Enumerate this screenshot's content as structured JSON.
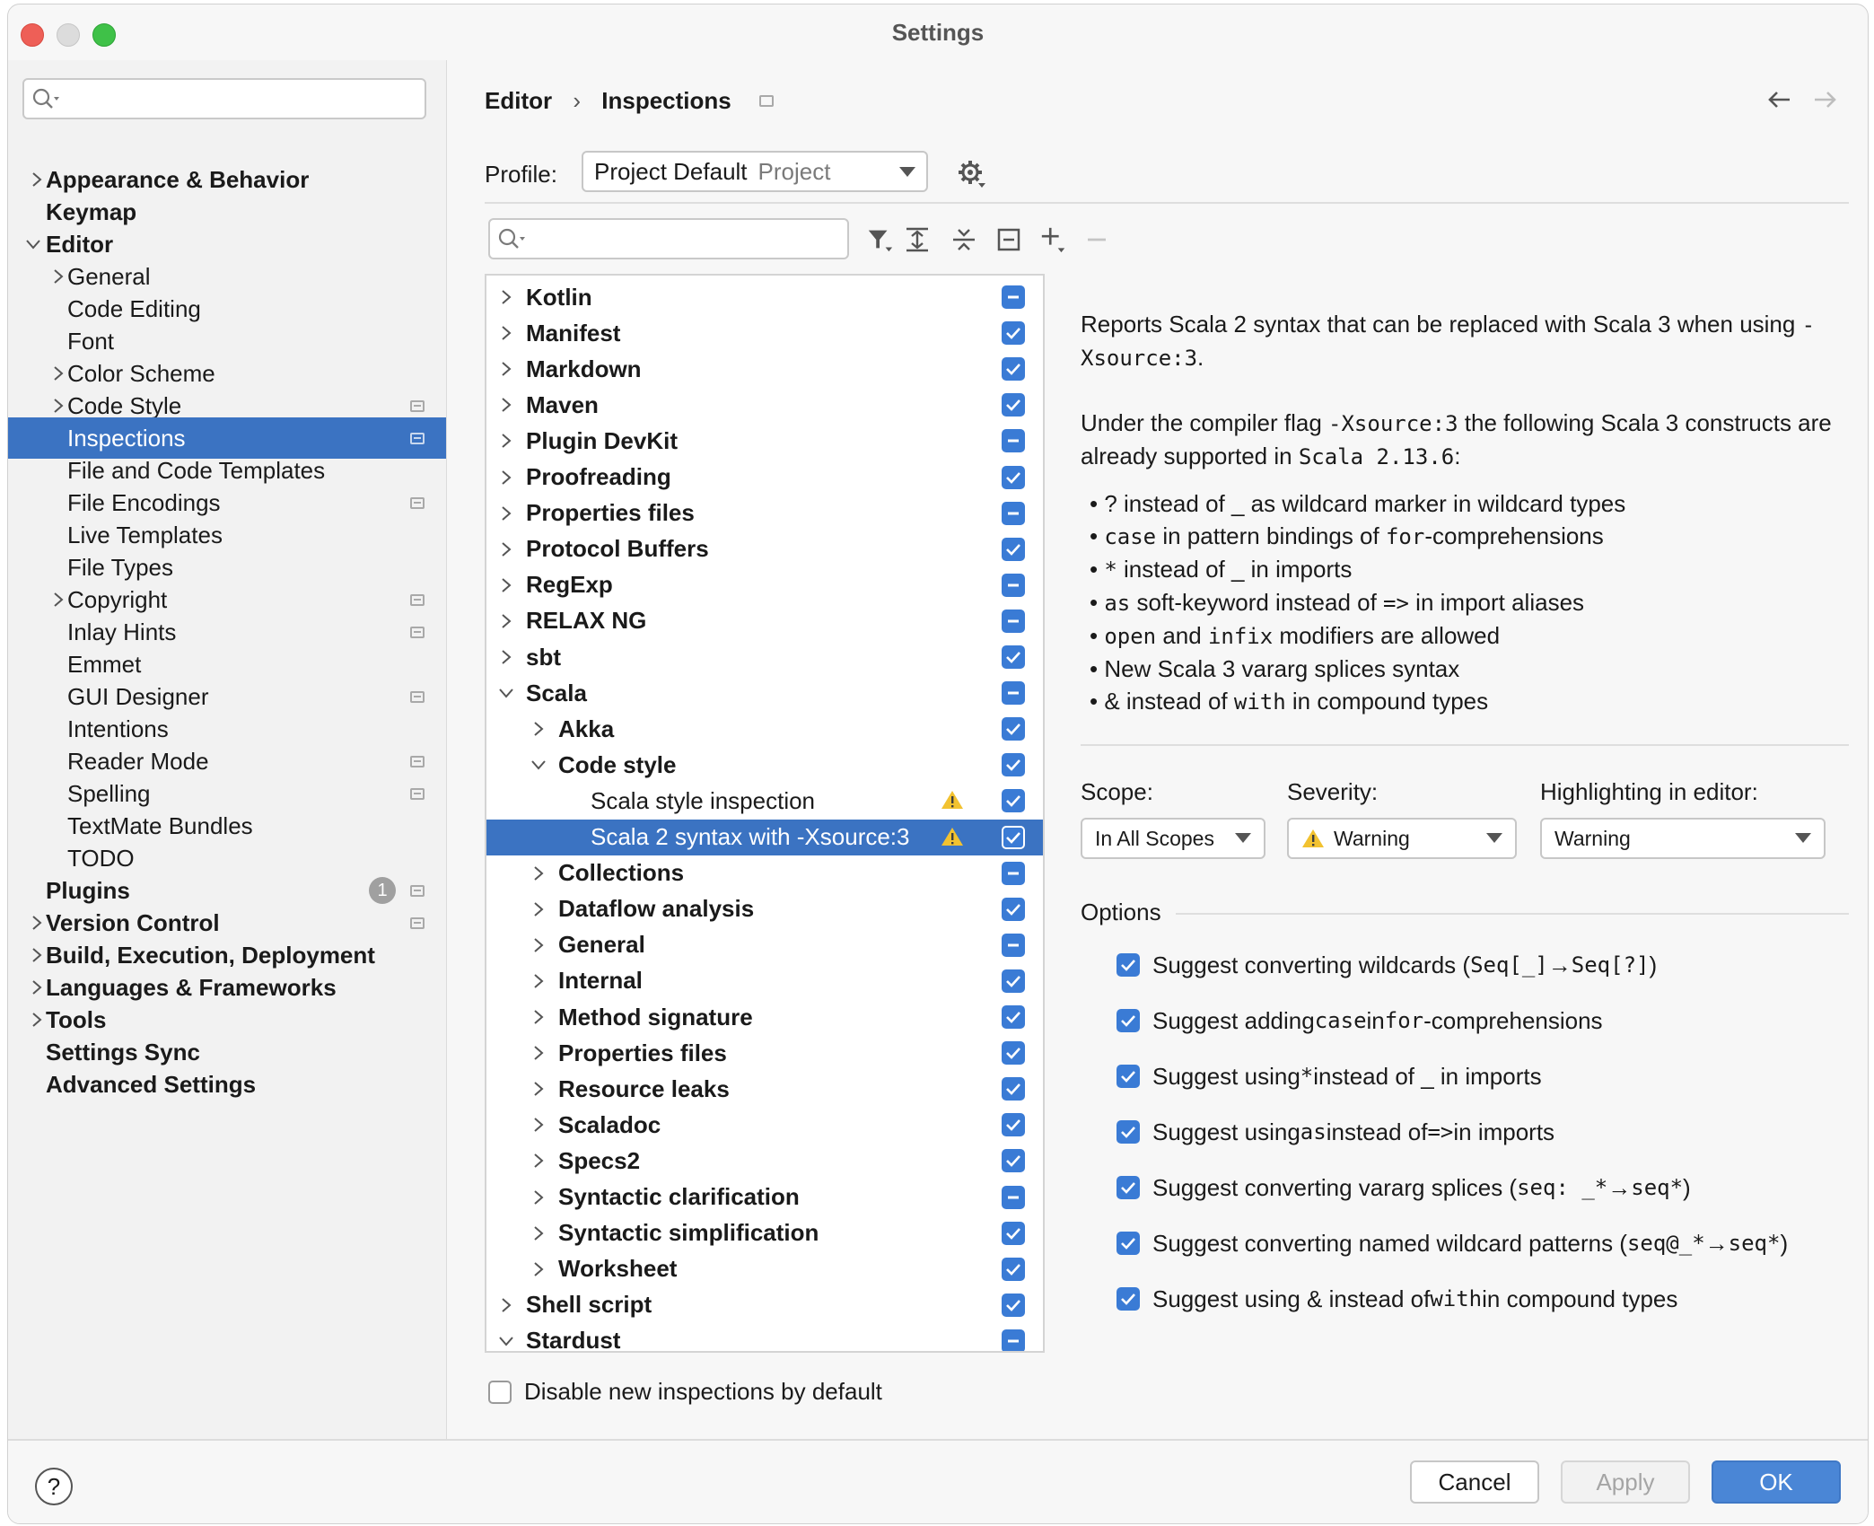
{
  "window": {
    "title": "Settings"
  },
  "sidebar": {
    "search": {
      "placeholder": ""
    },
    "items": [
      {
        "label": "Appearance & Behavior"
      },
      {
        "label": "Keymap"
      },
      {
        "label": "Editor"
      },
      {
        "label": "General"
      },
      {
        "label": "Code Editing"
      },
      {
        "label": "Font"
      },
      {
        "label": "Color Scheme"
      },
      {
        "label": "Code Style"
      },
      {
        "label": "Inspections"
      },
      {
        "label": "File and Code Templates"
      },
      {
        "label": "File Encodings"
      },
      {
        "label": "Live Templates"
      },
      {
        "label": "File Types"
      },
      {
        "label": "Copyright"
      },
      {
        "label": "Inlay Hints"
      },
      {
        "label": "Emmet"
      },
      {
        "label": "GUI Designer"
      },
      {
        "label": "Intentions"
      },
      {
        "label": "Reader Mode"
      },
      {
        "label": "Spelling"
      },
      {
        "label": "TextMate Bundles"
      },
      {
        "label": "TODO"
      },
      {
        "label": "Plugins",
        "badge": "1"
      },
      {
        "label": "Version Control"
      },
      {
        "label": "Build, Execution, Deployment"
      },
      {
        "label": "Languages & Frameworks"
      },
      {
        "label": "Tools"
      },
      {
        "label": "Settings Sync"
      },
      {
        "label": "Advanced Settings"
      }
    ]
  },
  "breadcrumb": {
    "parent": "Editor",
    "separator": "›",
    "current": "Inspections"
  },
  "profile": {
    "label": "Profile:",
    "value": "Project Default",
    "scope": "Project"
  },
  "tree": {
    "rows": [
      {
        "label": "Kotlin"
      },
      {
        "label": "Manifest"
      },
      {
        "label": "Markdown"
      },
      {
        "label": "Maven"
      },
      {
        "label": "Plugin DevKit"
      },
      {
        "label": "Proofreading"
      },
      {
        "label": "Properties files"
      },
      {
        "label": "Protocol Buffers"
      },
      {
        "label": "RegExp"
      },
      {
        "label": "RELAX NG"
      },
      {
        "label": "sbt"
      },
      {
        "label": "Scala"
      },
      {
        "label": "Akka"
      },
      {
        "label": "Code style"
      },
      {
        "label": "Scala style inspection"
      },
      {
        "label": "Scala 2 syntax with -Xsource:3"
      },
      {
        "label": "Collections"
      },
      {
        "label": "Dataflow analysis"
      },
      {
        "label": "General"
      },
      {
        "label": "Internal"
      },
      {
        "label": "Method signature"
      },
      {
        "label": "Properties files"
      },
      {
        "label": "Resource leaks"
      },
      {
        "label": "Scaladoc"
      },
      {
        "label": "Specs2"
      },
      {
        "label": "Syntactic clarification"
      },
      {
        "label": "Syntactic simplification"
      },
      {
        "label": "Worksheet"
      },
      {
        "label": "Shell script"
      },
      {
        "label": "Stardust"
      }
    ]
  },
  "description": {
    "p1_a": "Reports Scala 2 syntax that can be replaced with Scala 3 when using ",
    "p1_code": "-Xsource:3",
    "p1_b": ".",
    "p2_a": "Under the compiler flag ",
    "p2_code1": "-Xsource:3",
    "p2_b": " the following Scala 3 constructs are already supported in ",
    "p2_code2": "Scala 2.13.6",
    "p2_c": ":",
    "b1_a": "? instead of _ as wildcard marker in wildcard types",
    "b2_code": "case",
    "b2_a": " in pattern bindings of ",
    "b2_code2": "for",
    "b2_b": "-comprehensions",
    "b3_code": "*",
    "b3_a": " instead of _ in imports",
    "b4_code": "as",
    "b4_a": " soft-keyword instead of ",
    "b4_code2": "=>",
    "b4_b": " in import aliases",
    "b5_code": "open",
    "b5_a": " and ",
    "b5_code2": "infix",
    "b5_b": " modifiers are allowed",
    "b6_a": "New Scala 3 vararg splices syntax",
    "b7_a": "& instead of ",
    "b7_code": "with",
    "b7_b": " in compound types"
  },
  "settings": {
    "scope_label": "Scope:",
    "scope_value": "In All Scopes",
    "severity_label": "Severity:",
    "severity_value": "Warning",
    "highlight_label": "Highlighting in editor:",
    "highlight_value": "Warning"
  },
  "options": {
    "title": "Options",
    "o1_a": "Suggest converting wildcards (",
    "o1_code": "Seq[_]",
    "o1_arrow": " → ",
    "o1_code2": "Seq[?]",
    "o1_b": ")",
    "o2_a": "Suggest adding ",
    "o2_code": "case",
    "o2_b": " in ",
    "o2_code2": "for",
    "o2_c": "-comprehensions",
    "o3_a": "Suggest using ",
    "o3_code": "*",
    "o3_b": " instead of _ in imports",
    "o4_a": "Suggest using ",
    "o4_code": "as",
    "o4_b": " instead of ",
    "o4_code2": "=>",
    "o4_c": " in imports",
    "o5_a": "Suggest converting vararg splices (",
    "o5_code": "seq: _*",
    "o5_arrow": " → ",
    "o5_code2": "seq*",
    "o5_b": ")",
    "o6_a": "Suggest converting named wildcard patterns (",
    "o6_code": "seq@_*",
    "o6_arrow": " → ",
    "o6_code2": "seq*",
    "o6_b": ")",
    "o7_a": "Suggest using & instead of ",
    "o7_code": "with",
    "o7_b": " in compound types"
  },
  "disable_new": {
    "label": "Disable new inspections by default"
  },
  "footer": {
    "help": "?",
    "cancel": "Cancel",
    "apply": "Apply",
    "ok": "OK"
  },
  "colors": {
    "accent": "#3b73c2",
    "checkbox": "#3a7bd5",
    "ok_button": "#4a86d6",
    "warning": "#f2c230"
  }
}
